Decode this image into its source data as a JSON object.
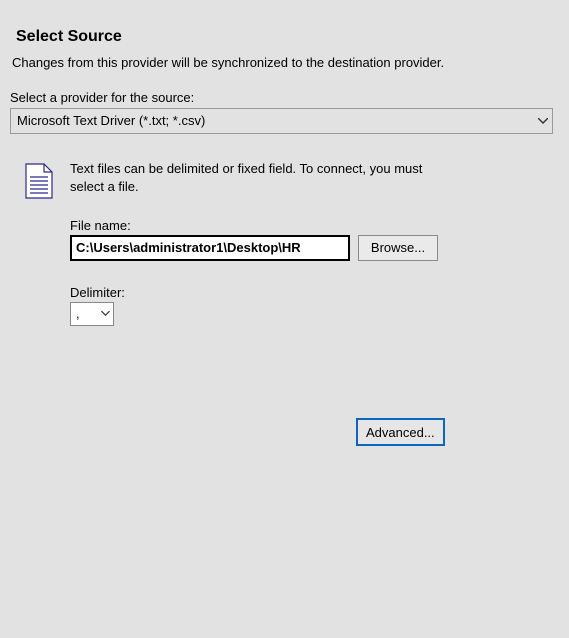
{
  "header": {
    "title": "Select Source",
    "description": "Changes from this provider will be synchronized to the destination provider."
  },
  "provider": {
    "label": "Select a provider for the source:",
    "selected": "Microsoft Text Driver (*.txt; *.csv)"
  },
  "details": {
    "hint": "Text files can be delimited or fixed field. To connect, you must select a file.",
    "file_label": "File name:",
    "file_value": "C:\\Users\\administrator1\\Desktop\\HR",
    "browse_label": "Browse...",
    "delimiter_label": "Delimiter:",
    "delimiter_value": ","
  },
  "buttons": {
    "advanced": "Advanced..."
  },
  "icons": {
    "document": "document-icon",
    "chevron": "chevron-down-icon"
  }
}
